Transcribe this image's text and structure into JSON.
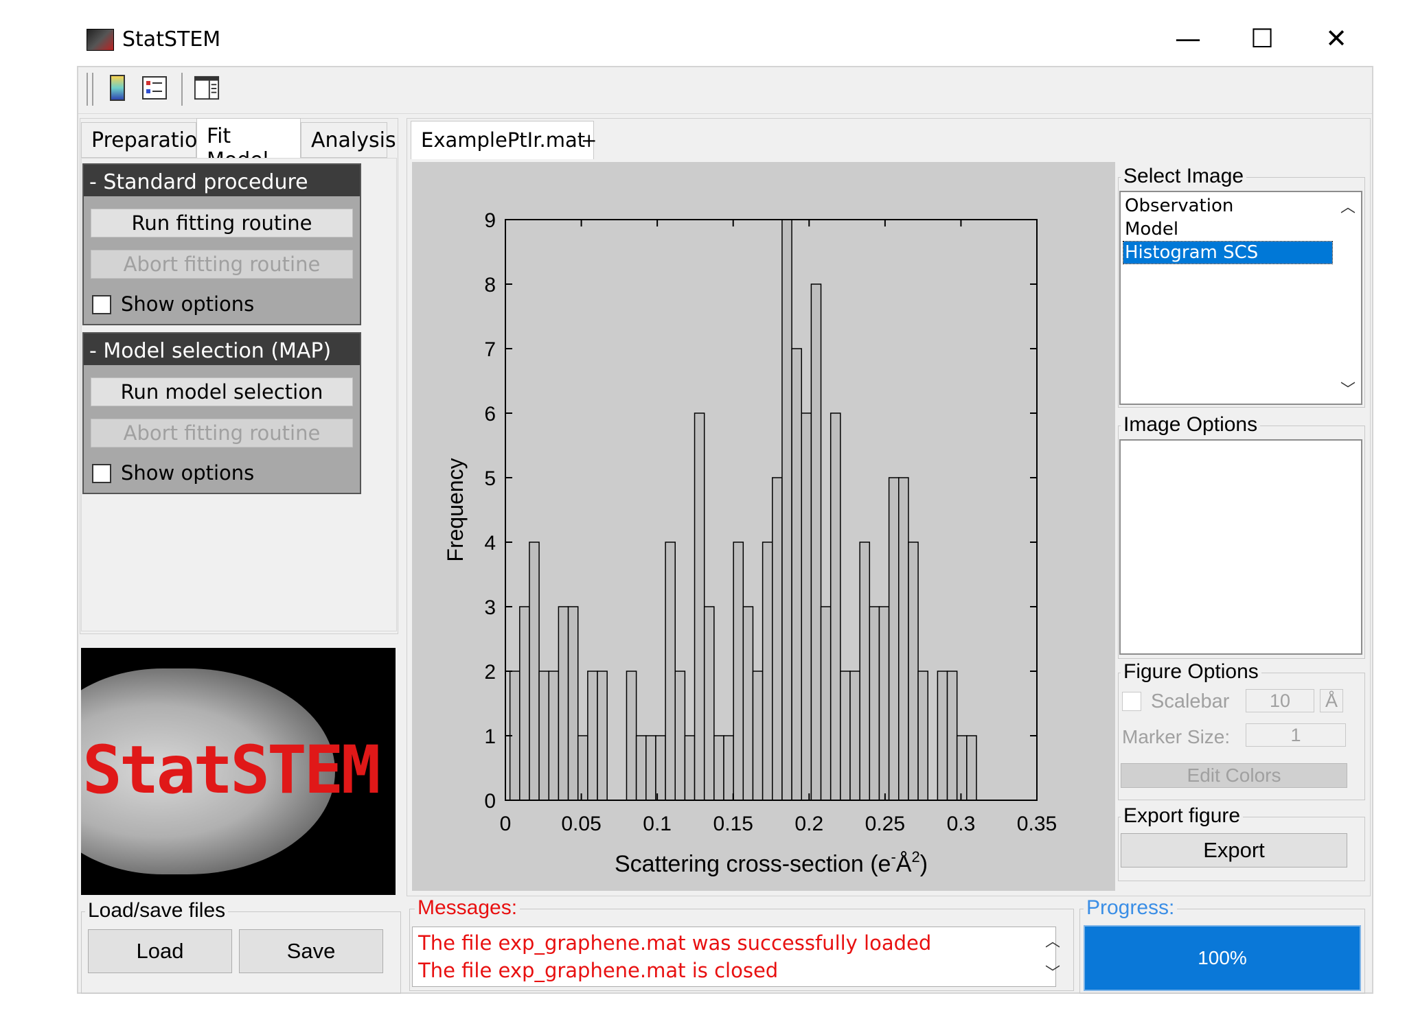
{
  "window": {
    "title": "StatSTEM",
    "controls": {
      "minimize": "—",
      "maximize": "☐",
      "close": "✕"
    }
  },
  "toolbar": {
    "icons": [
      "colorbar-icon",
      "legend-icon",
      "panel-layout-icon"
    ]
  },
  "left_tabs": [
    "Preparation",
    "Fit Model",
    "Analysis"
  ],
  "active_left_tab": "Fit Model",
  "standard_procedure": {
    "header": "- Standard procedure",
    "run_label": "Run fitting routine",
    "abort_label": "Abort fitting routine",
    "show_options_label": "Show options"
  },
  "model_selection": {
    "header": "- Model selection (MAP)",
    "run_label": "Run model selection",
    "abort_label": "Abort fitting routine",
    "show_options_label": "Show options"
  },
  "logo": {
    "text": "StatSTEM"
  },
  "load_save": {
    "legend": "Load/save files",
    "load_label": "Load",
    "save_label": "Save"
  },
  "file_tab": {
    "label": "ExamplePtIr.mat",
    "add_label": "+"
  },
  "select_image": {
    "legend": "Select Image",
    "items": [
      "Observation",
      "Model",
      "Histogram SCS"
    ],
    "selected": "Histogram SCS"
  },
  "image_options": {
    "legend": "Image Options"
  },
  "figure_options": {
    "legend": "Figure Options",
    "scalebar_label": "Scalebar",
    "scalebar_value": "10",
    "scalebar_unit": "Å",
    "marker_size_label": "Marker Size:",
    "marker_size_value": "1",
    "edit_colors_label": "Edit Colors"
  },
  "export_figure": {
    "legend": "Export figure",
    "export_label": "Export"
  },
  "messages": {
    "legend": "Messages:",
    "lines": [
      "The file exp_graphene.mat was successfully loaded",
      "The file exp_graphene.mat is closed"
    ]
  },
  "progress": {
    "legend": "Progress:",
    "value": 100,
    "text": "100%"
  },
  "chart_data": {
    "type": "bar",
    "xlabel": "Scattering cross-section (e",
    "xlabel_sup1": "-",
    "xlabel_mid": "Å",
    "xlabel_sup2": "2",
    "xlabel_end": ")",
    "ylabel": "Frequency",
    "xlim": [
      0,
      0.35
    ],
    "ylim": [
      0,
      9
    ],
    "xticks": [
      "0",
      "0.05",
      "0.1",
      "0.15",
      "0.2",
      "0.25",
      "0.3",
      "0.35"
    ],
    "yticks": [
      "0",
      "1",
      "2",
      "3",
      "4",
      "5",
      "6",
      "7",
      "8",
      "9"
    ],
    "bin_start": 0.003,
    "bin_width": 0.0064,
    "values": [
      2,
      3,
      4,
      2,
      2,
      3,
      3,
      1,
      2,
      2,
      0,
      0,
      2,
      1,
      1,
      1,
      4,
      2,
      1,
      6,
      3,
      1,
      1,
      4,
      3,
      2,
      4,
      5,
      9,
      7,
      6,
      8,
      3,
      6,
      2,
      2,
      4,
      3,
      3,
      5,
      5,
      4,
      2,
      0,
      2,
      2,
      1,
      1
    ],
    "bar_color": "#bebebe",
    "grid": false
  },
  "colors": {
    "accent_blue": "#0078d7",
    "progress_blue": "#0a78d8",
    "message_red": "#e81010",
    "header_dark": "#3c3c3c"
  }
}
